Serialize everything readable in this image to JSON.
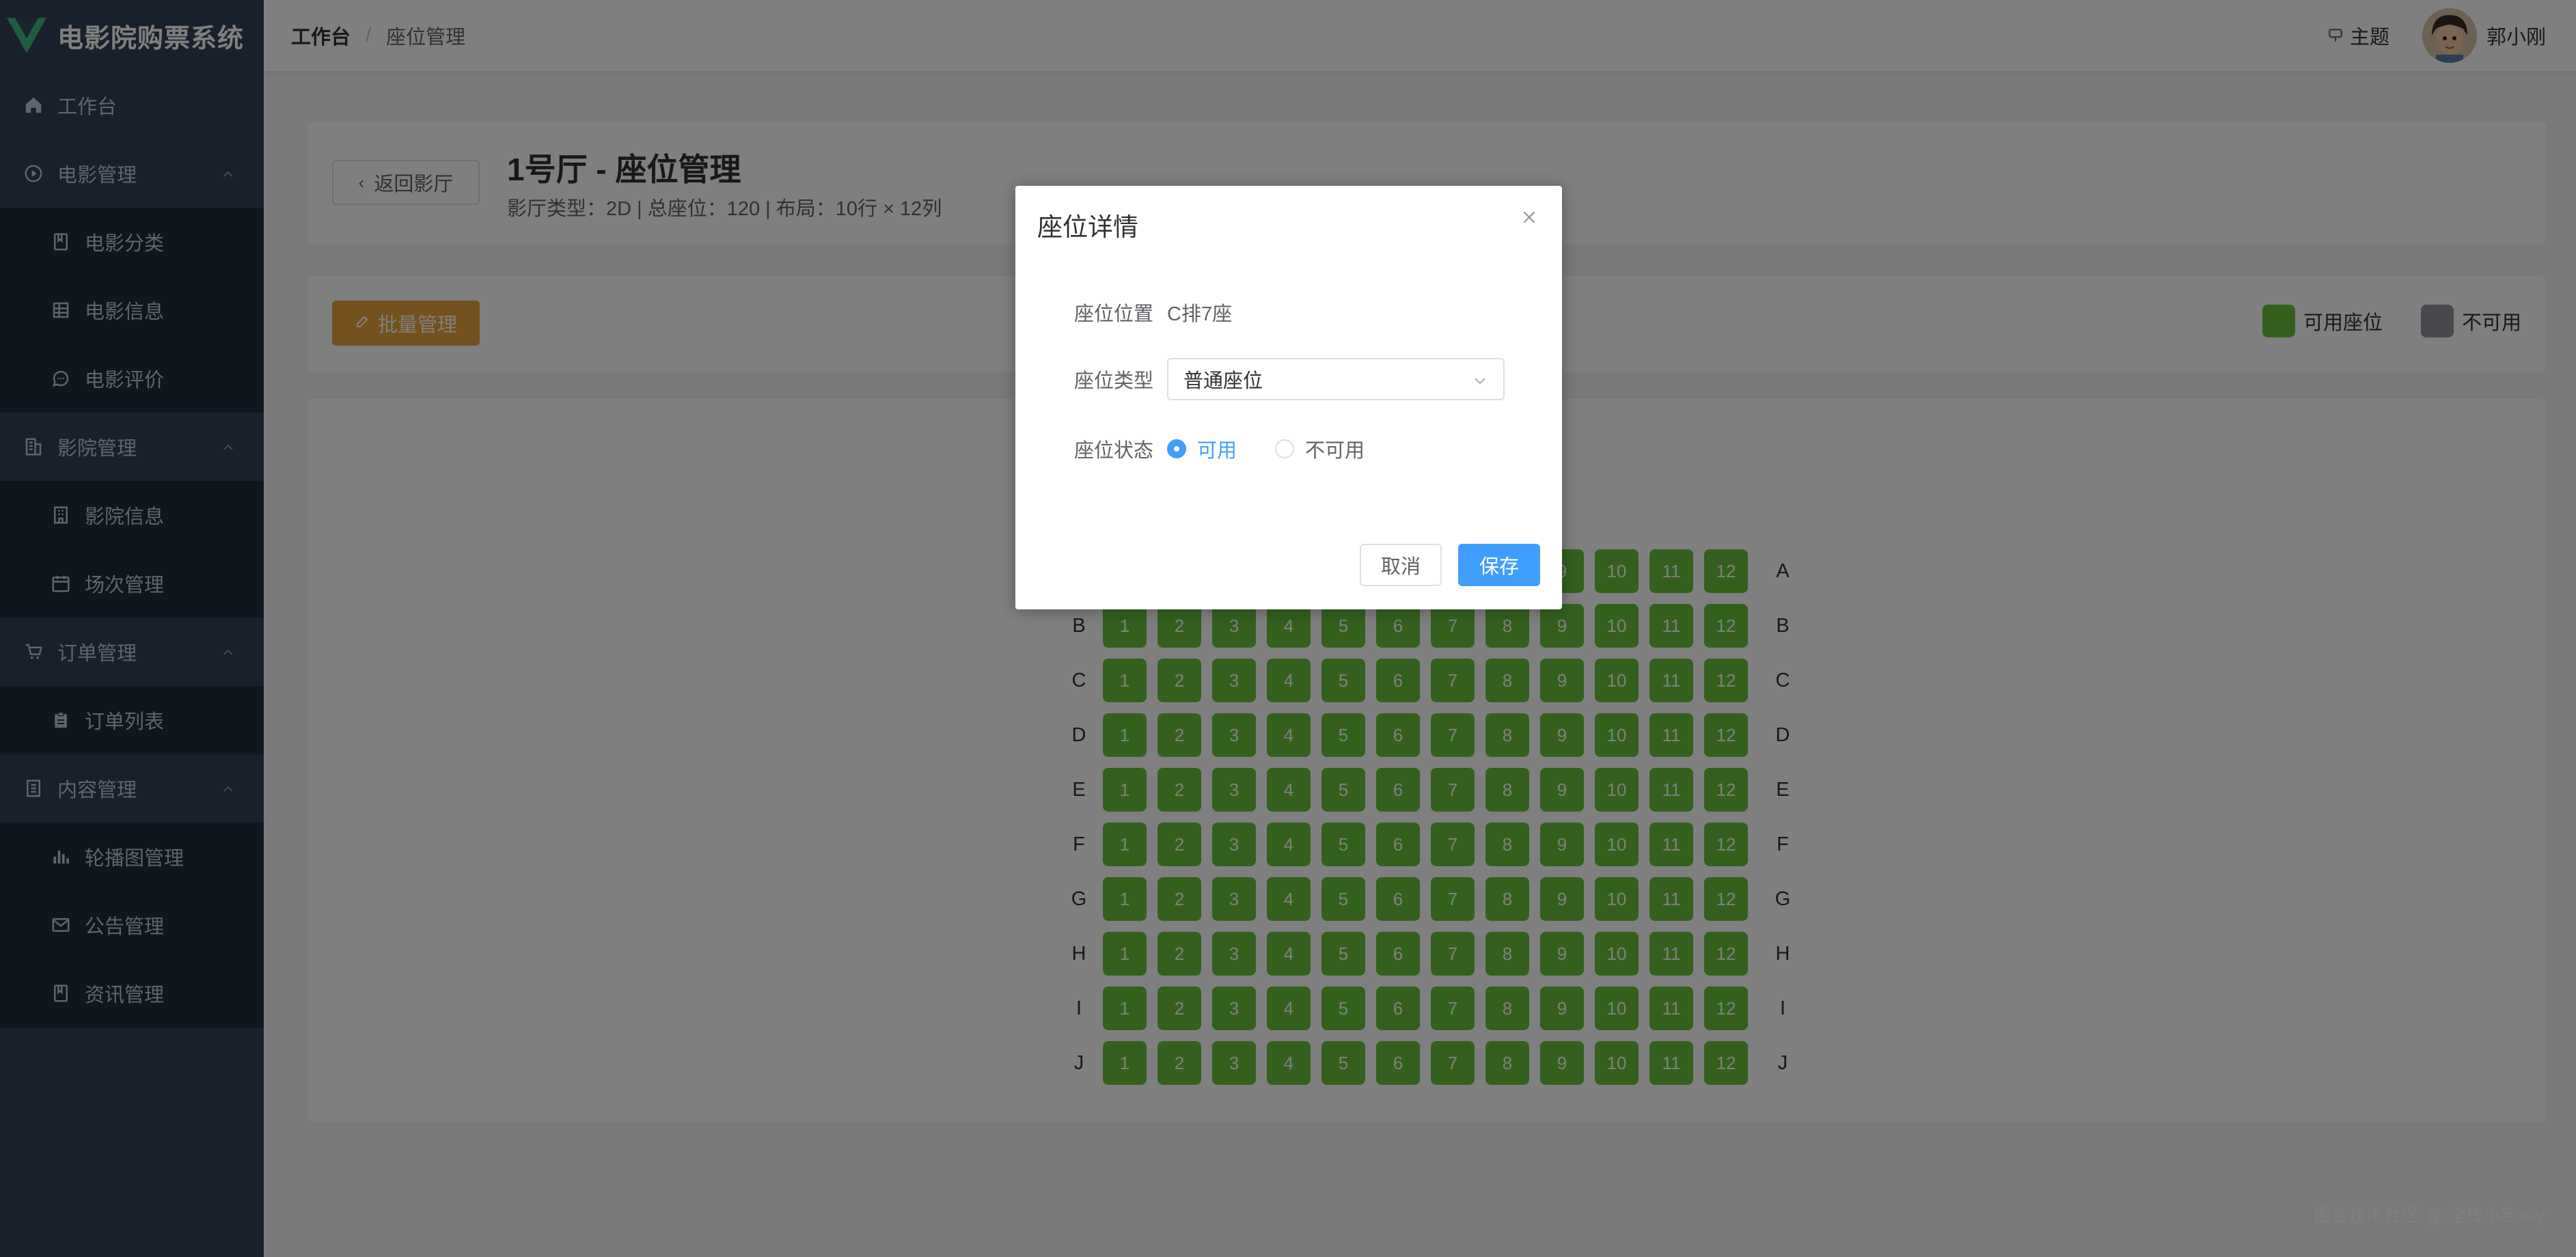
{
  "app": {
    "title": "电影院购票系统"
  },
  "sidebar": {
    "items": [
      {
        "label": "工作台",
        "icon": "home-icon",
        "level": 1
      },
      {
        "label": "电影管理",
        "icon": "play-circle-icon",
        "level": 1,
        "expanded": true
      },
      {
        "label": "电影分类",
        "icon": "book-icon",
        "level": 2
      },
      {
        "label": "电影信息",
        "icon": "grid-icon",
        "level": 2
      },
      {
        "label": "电影评价",
        "icon": "chat-icon",
        "level": 2
      },
      {
        "label": "影院管理",
        "icon": "building-icon",
        "level": 1,
        "expanded": true
      },
      {
        "label": "影院信息",
        "icon": "office-icon",
        "level": 2
      },
      {
        "label": "场次管理",
        "icon": "calendar-icon",
        "level": 2
      },
      {
        "label": "订单管理",
        "icon": "cart-icon",
        "level": 1,
        "expanded": true
      },
      {
        "label": "订单列表",
        "icon": "clipboard-icon",
        "level": 2
      },
      {
        "label": "内容管理",
        "icon": "document-icon",
        "level": 1,
        "expanded": true
      },
      {
        "label": "轮播图管理",
        "icon": "bar-chart-icon",
        "level": 2
      },
      {
        "label": "公告管理",
        "icon": "mail-icon",
        "level": 2
      },
      {
        "label": "资讯管理",
        "icon": "book-icon",
        "level": 2
      }
    ]
  },
  "header": {
    "breadcrumb": [
      "工作台",
      "座位管理"
    ],
    "theme_label": "主题",
    "user_name": "郭小刚"
  },
  "hall": {
    "back_label": "返回影厅",
    "title": "1号厅 - 座位管理",
    "info": "影厅类型：2D | 总座位：120 | 布局：10行 × 12列"
  },
  "toolbar": {
    "batch_label": "批量管理"
  },
  "legend": [
    {
      "label": "可用座位",
      "color": "#67c23a"
    },
    {
      "label": "不可用",
      "color": "#909399"
    }
  ],
  "seats": {
    "rows": [
      "A",
      "B",
      "C",
      "D",
      "E",
      "F",
      "G",
      "H",
      "I",
      "J"
    ],
    "cols": [
      "1",
      "2",
      "3",
      "4",
      "5",
      "6",
      "7",
      "8",
      "9",
      "10",
      "11",
      "12"
    ],
    "available_color": "#67c23a"
  },
  "dialog": {
    "title": "座位详情",
    "position_label": "座位位置",
    "position_value": "C排7座",
    "type_label": "座位类型",
    "type_value": "普通座位",
    "status_label": "座位状态",
    "status_options": [
      "可用",
      "不可用"
    ],
    "status_selected": "可用",
    "cancel_label": "取消",
    "save_label": "保存"
  },
  "watermark": "掘金技术社区 @ 全栈小宇wly",
  "colors": {
    "sidebar_bg": "#304156",
    "submenu_bg": "#1f2d3d",
    "primary": "#409eff",
    "warning": "#e6a23c",
    "success": "#67c23a"
  }
}
